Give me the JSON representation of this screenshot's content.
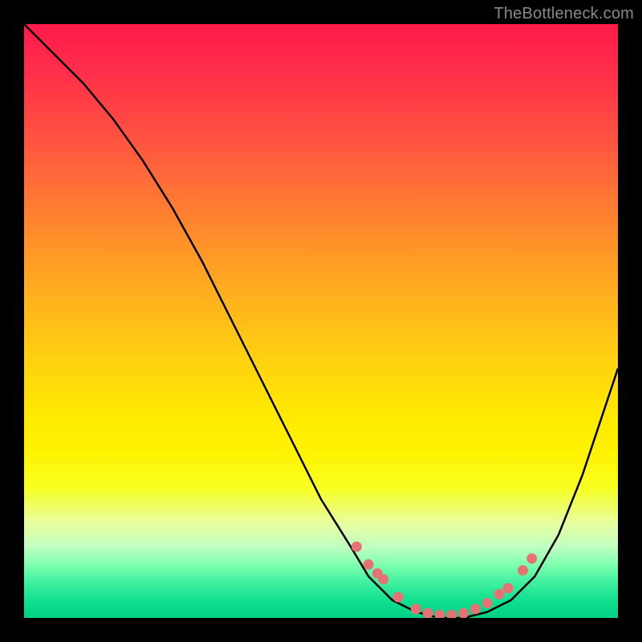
{
  "watermark": "TheBottleneck.com",
  "chart_data": {
    "type": "line",
    "title": "",
    "xlabel": "",
    "ylabel": "",
    "xlim": [
      0,
      100
    ],
    "ylim": [
      0,
      100
    ],
    "series": [
      {
        "name": "curve",
        "x": [
          0,
          5,
          10,
          15,
          20,
          25,
          30,
          35,
          40,
          45,
          50,
          55,
          58,
          62,
          66,
          70,
          74,
          78,
          82,
          86,
          90,
          94,
          98,
          100
        ],
        "y": [
          100,
          95,
          90,
          84,
          77,
          69,
          60,
          50,
          40,
          30,
          20,
          12,
          7,
          3,
          1,
          0,
          0,
          1,
          3,
          7,
          14,
          24,
          36,
          42
        ]
      }
    ],
    "scatter_points": {
      "name": "markers",
      "x": [
        56,
        58,
        59.5,
        60.5,
        63,
        66,
        68,
        70,
        72,
        74,
        76,
        78,
        80,
        81.5,
        84,
        85.5
      ],
      "y": [
        12,
        9,
        7.5,
        6.5,
        3.5,
        1.5,
        0.8,
        0.5,
        0.5,
        0.8,
        1.5,
        2.5,
        4,
        5,
        8,
        10
      ]
    },
    "annotations": []
  }
}
